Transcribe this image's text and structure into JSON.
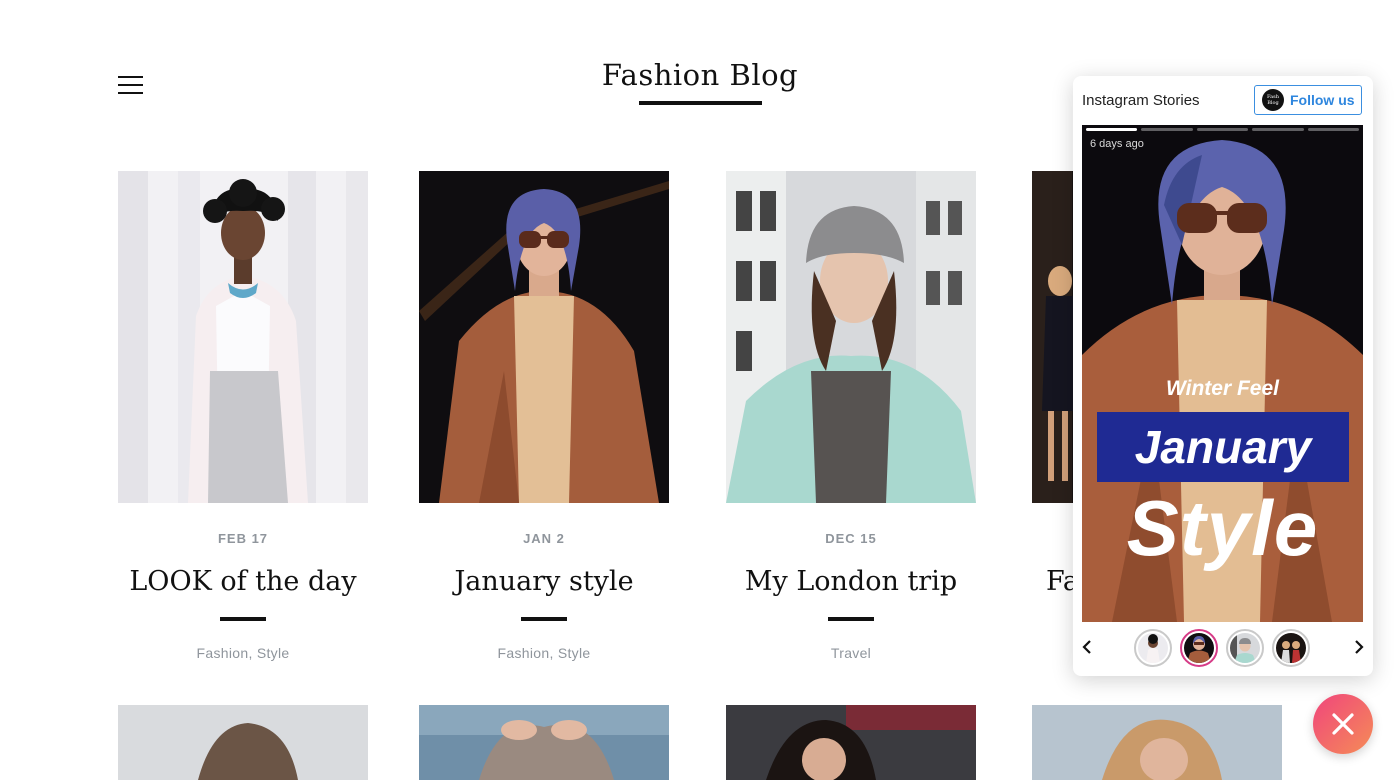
{
  "header": {
    "title": "Fashion Blog"
  },
  "posts": [
    {
      "date": "FEB 17",
      "title": "LOOK of the day",
      "tags": "Fashion, Style"
    },
    {
      "date": "JAN 2",
      "title": "January style",
      "tags": "Fashion, Style"
    },
    {
      "date": "DEC 15",
      "title": "My London trip",
      "tags": "Travel"
    },
    {
      "date": "",
      "title": "Fa",
      "tags": ""
    }
  ],
  "widget": {
    "title": "Instagram Stories",
    "follow_label": "Follow us",
    "follow_logo_text": "Fash Blog",
    "story": {
      "time": "6 days ago",
      "subtitle": "Winter Feel",
      "headline": "January",
      "big_text": "Style",
      "segments": 5,
      "active_segment": 1
    },
    "thumbs_count": 4,
    "active_thumb": 2,
    "prev_icon": "chevron-left-icon",
    "next_icon": "chevron-right-icon"
  },
  "fab": {
    "icon": "close-icon"
  },
  "colors": {
    "accent_blue": "#2e86de",
    "story_banner": "#1f2a93",
    "fab_gradient_start": "#f0457c",
    "fab_gradient_end": "#f58c57",
    "meta_gray": "#8f959c"
  }
}
